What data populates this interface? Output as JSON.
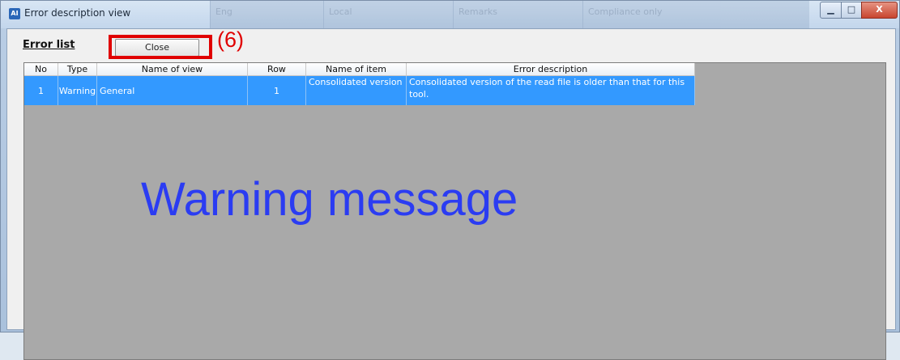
{
  "window": {
    "title": "Error description view",
    "app_icon_text": "AI",
    "controls": {
      "minimize": "▁",
      "maximize": "□",
      "close": "X"
    }
  },
  "background_window_columns": [
    "Eng",
    "Local",
    "Remarks",
    "Compliance only"
  ],
  "toolbar": {
    "error_list_label": "Error list",
    "close_label": "Close",
    "callout_label": "(6)"
  },
  "table": {
    "columns": [
      "No",
      "Type",
      "Name of view",
      "Row",
      "Name of item",
      "Error description"
    ],
    "rows": [
      {
        "no": "1",
        "type": "Warning",
        "name_of_view": "General",
        "row": "1",
        "name_of_item": "Consolidated version",
        "error_description": "Consolidated version of the read file is older than that for this tool."
      }
    ]
  },
  "overlay": {
    "text": "Warning message",
    "color": "#2b3cf2"
  },
  "colors": {
    "selection": "#3399ff",
    "grid_background": "#a9a9a9",
    "highlight_border": "#e00000"
  }
}
